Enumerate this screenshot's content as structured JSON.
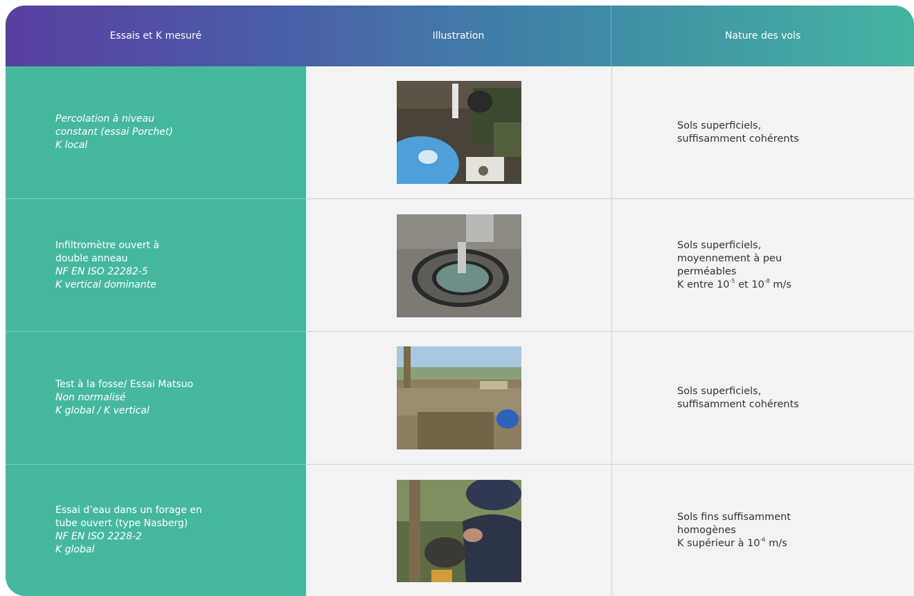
{
  "header": {
    "col1": "Essais et K mesuré",
    "col2": "Illustration",
    "col3": "Nature des vols"
  },
  "rows": [
    {
      "test_lines": [
        "Percolation à niveau",
        "constant (essai Porchet)",
        "K local"
      ],
      "photo": "porchet-test-photo",
      "nature_lines": [
        "Sols superficiels,",
        "suffisamment cohérents"
      ]
    },
    {
      "test_lines": [
        "Infiltromètre ouvert à",
        "double anneau",
        "NF EN ISO 22282-5",
        "K vertical dominante"
      ],
      "photo": "double-ring-infiltrometer-photo",
      "nature_lines": [
        "Sols superficiels,",
        "moyennement à peu",
        "perméables"
      ],
      "nature_k": {
        "prefix": "K entre 10",
        "exp1": "-5",
        "mid": " et 10",
        "exp2": "-8",
        "suffix": " m/s"
      }
    },
    {
      "test_lines": [
        "Test à la fosse/ Essai Matsuo",
        "Non normalisé",
        "K global / K vertical"
      ],
      "photo": "matsuo-pit-test-photo",
      "nature_lines": [
        "Sols superficiels,",
        "suffisamment cohérents"
      ]
    },
    {
      "test_lines": [
        "Essai d’eau dans un forage en",
        "tube ouvert (type Nasberg)",
        "NF EN ISO 2228-2",
        "K global"
      ],
      "photo": "nasberg-borehole-test-photo",
      "nature_lines": [
        "Sols fins suffisamment",
        "homogènes"
      ],
      "nature_k": {
        "prefix": "K supérieur à 10",
        "exp1": "-6",
        "suffix": " m/s"
      }
    }
  ]
}
